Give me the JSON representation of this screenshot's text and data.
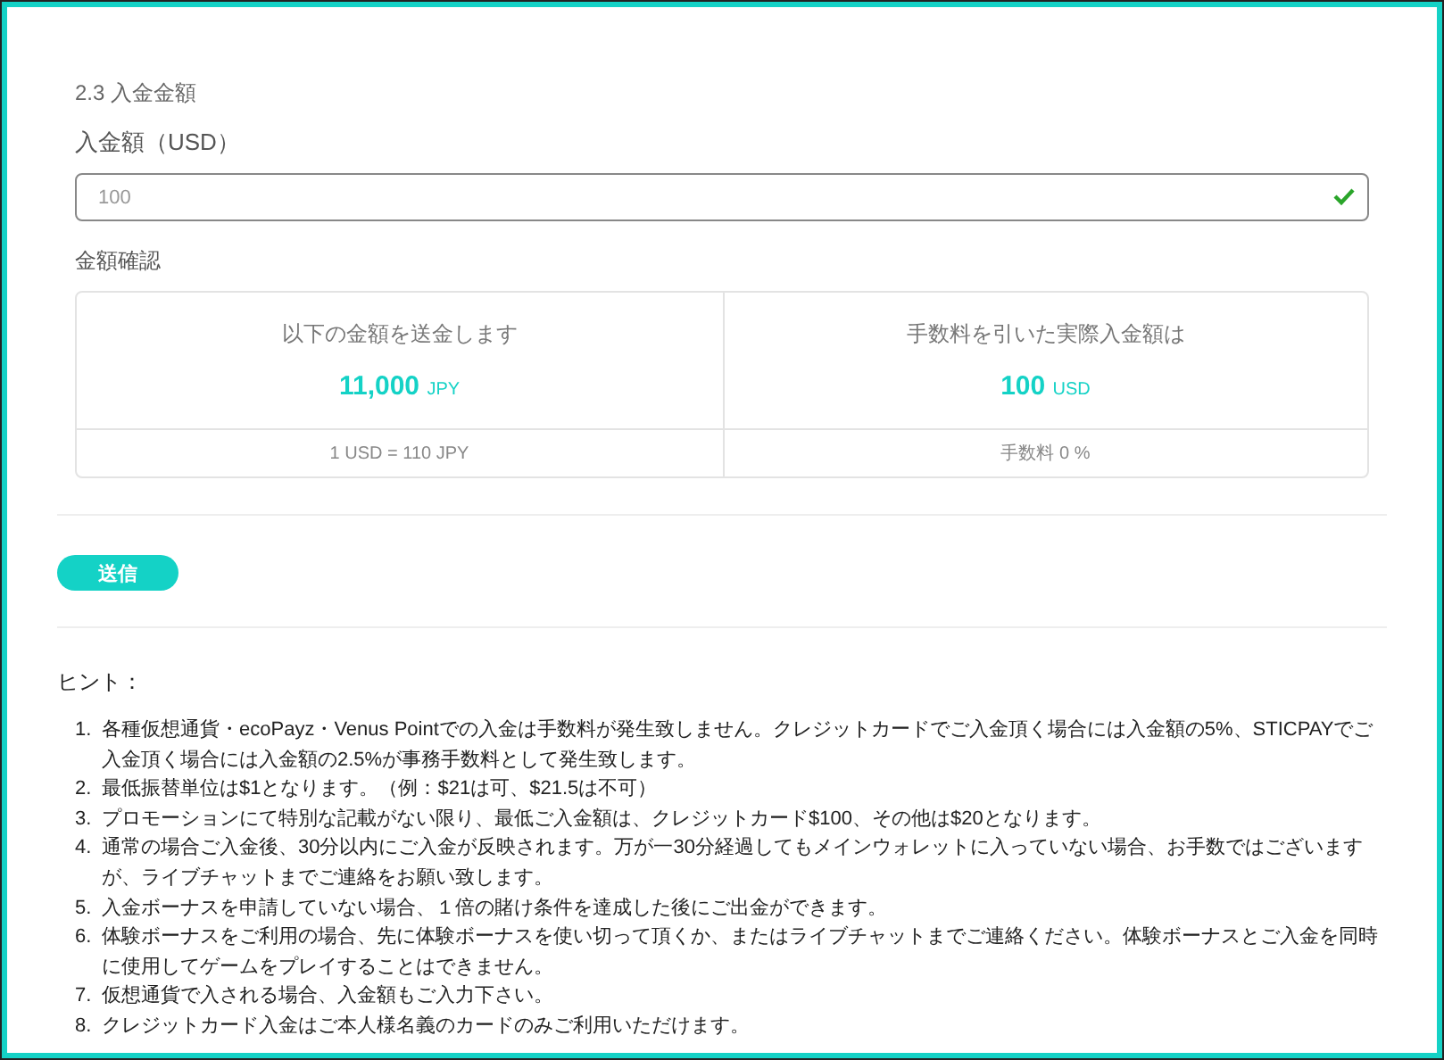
{
  "section_title": "2.3 入金金額",
  "amount_field": {
    "label": "入金額（USD）",
    "value": "100",
    "valid": true
  },
  "confirm": {
    "title": "金額確認",
    "columns": [
      {
        "caption": "以下の金額を送金します",
        "amount": "11,000",
        "unit": "JPY",
        "note": "1 USD = 110 JPY"
      },
      {
        "caption": "手数料を引いた実際入金額は",
        "amount": "100",
        "unit": "USD",
        "note": "手数料 0 %"
      }
    ]
  },
  "submit_button": "送信",
  "hints": {
    "title": "ヒント：",
    "numbers": [
      "1.",
      "2.",
      "3.",
      "4.",
      "5.",
      "6.",
      "7.",
      "8."
    ],
    "items": [
      "各種仮想通貨・ecoPayz・Venus Pointでの入金は手数料が発生致しません。クレジットカードでご入金頂く場合には入金額の5%、STICPAYでご入金頂く場合には入金額の2.5%が事務手数料として発生致します。",
      "最低振替単位は$1となります。（例：$21は可、$21.5は不可）",
      "プロモーションにて特別な記載がない限り、最低ご入金額は、クレジットカード$100、その他は$20となります。",
      "通常の場合ご入金後、30分以内にご入金が反映されます。万が一30分経過してもメインウォレットに入っていない場合、お手数ではございますが、ライブチャットまでご連絡をお願い致します。",
      "入金ボーナスを申請していない場合、１倍の賭け条件を達成した後にご出金ができます。",
      "体験ボーナスをご利用の場合、先に体験ボーナスを使い切って頂くか、またはライブチャットまでご連絡ください。体験ボーナスとご入金を同時に使用してゲームをプレイすることはできません。",
      "仮想通貨で入される場合、入金額もご入力下さい。",
      "クレジットカード入金はご本人様名義のカードのみご利用いただけます。"
    ]
  }
}
